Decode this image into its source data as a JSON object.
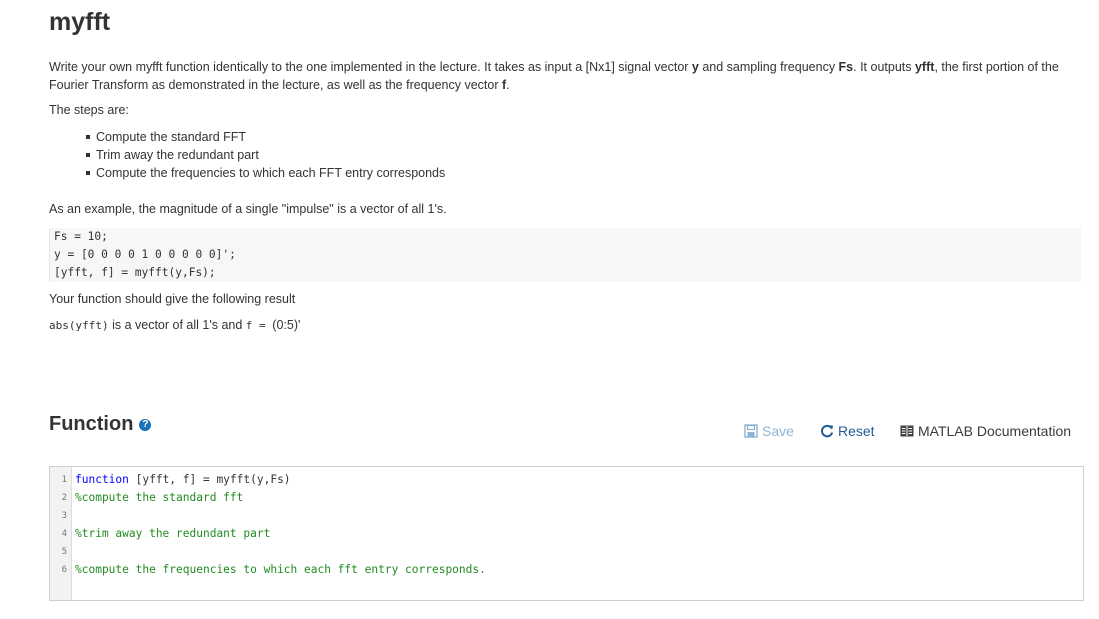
{
  "page": {
    "title": "myfft",
    "intro": {
      "t1": "Write your own myfft function identically to the one implemented in the lecture. It takes as input a [Nx1] signal vector ",
      "b1": "y",
      "t2": " and sampling frequency ",
      "b2": "Fs",
      "t3": ". It outputs ",
      "b3": "yfft",
      "t4": ", the first portion of the Fourier Transform as demonstrated in the lecture, as well as the frequency vector ",
      "b4": "f",
      "t5": "."
    },
    "steps_label": "The steps are:",
    "steps": [
      "Compute the standard FFT",
      "Trim away the redundant part",
      "Compute the frequencies to which each FFT entry corresponds"
    ],
    "example_text": "As an example, the magnitude of a single \"impulse\" is a vector of all 1's.",
    "example_code": [
      "Fs = 10;",
      "y = [0 0 0 0 1 0 0 0 0 0]';",
      "[yfft, f] = myfft(y,Fs);"
    ],
    "result_text": "Your function should give the following result",
    "result": {
      "code1": "abs(yfft)",
      "t1": " is a vector of all 1's and ",
      "code2": "f = ",
      "t2": "(0:5)'"
    }
  },
  "function_section": {
    "heading": "Function",
    "help_icon": "?",
    "toolbar": {
      "save_label": "Save",
      "reset_label": "Reset",
      "doc_label": "MATLAB Documentation"
    },
    "editor": {
      "line_numbers": [
        "1",
        "2",
        "3",
        "4",
        "5",
        "6"
      ],
      "line1_keyword": "function",
      "line1_rest": " [yfft, f] = myfft(y,Fs)",
      "line2": "%compute the standard fft",
      "line4": "%trim away the redundant part",
      "line6": "%compute the frequencies to which each fft entry corresponds."
    }
  },
  "colors": {
    "keyword": "#0000ff",
    "comment": "#228b22",
    "link": "#1f5c94",
    "save_disabled": "#8fb4d3"
  }
}
